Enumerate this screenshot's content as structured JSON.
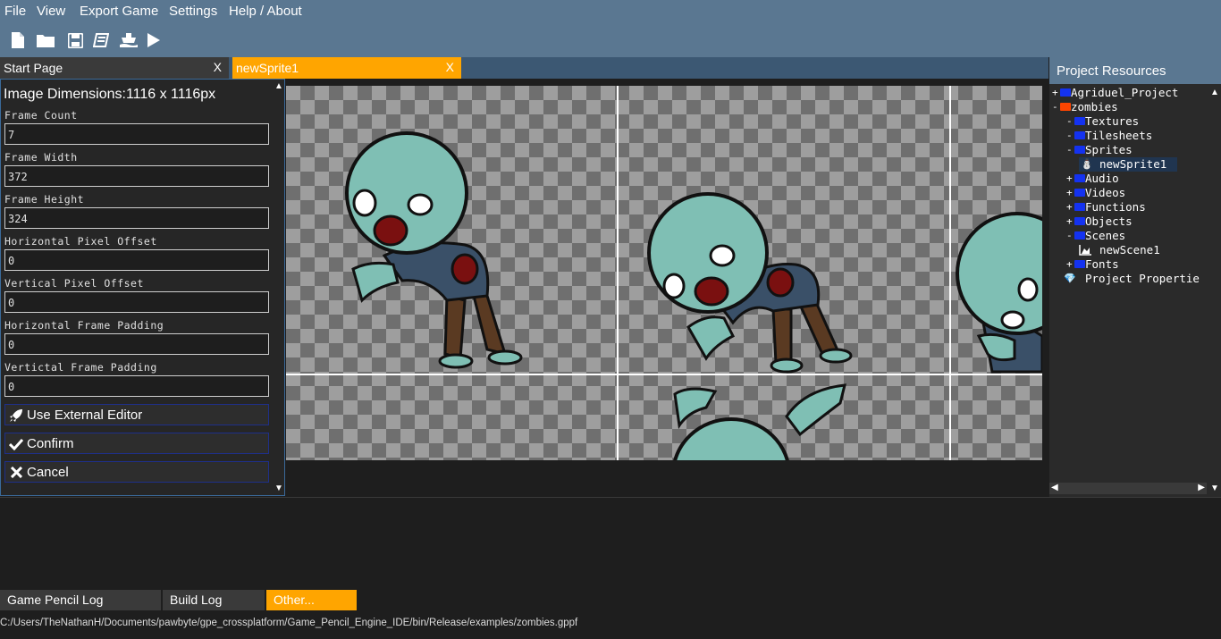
{
  "menu": {
    "file": "File",
    "view": "View",
    "export": "Export Game",
    "settings": "Settings",
    "help": "Help / About"
  },
  "toolbar": {
    "icons": [
      "new-file-icon",
      "open-folder-icon",
      "save-icon",
      "save-all-icon",
      "build-icon",
      "play-icon"
    ]
  },
  "tabs": [
    {
      "label": "Start Page",
      "close": "X"
    },
    {
      "label": "newSprite1",
      "close": "X"
    }
  ],
  "sprite_editor": {
    "dimensions": "Image Dimensions:1116 x 1116px",
    "fields": [
      {
        "label": "Frame Count",
        "value": "7"
      },
      {
        "label": "Frame Width",
        "value": "372"
      },
      {
        "label": "Frame Height",
        "value": "324"
      },
      {
        "label": "Horizontal Pixel  Offset",
        "value": "0"
      },
      {
        "label": "Vertical Pixel Offset",
        "value": "0"
      },
      {
        "label": "Horizontal Frame Padding",
        "value": "0"
      },
      {
        "label": "Vertictal Frame Padding",
        "value": "0"
      }
    ],
    "buttons": {
      "external": "Use External Editor",
      "confirm": "Confirm",
      "cancel": "Cancel"
    }
  },
  "resources": {
    "title": "Project Resources",
    "tree": [
      {
        "pm": "+",
        "label": "Agriduel_Project",
        "kind": "folder"
      },
      {
        "pm": "-",
        "label": "zombies",
        "kind": "project"
      },
      {
        "pm": "-",
        "label": "Textures",
        "kind": "folder"
      },
      {
        "pm": "-",
        "label": "Tilesheets",
        "kind": "folder"
      },
      {
        "pm": "-",
        "label": "Sprites",
        "kind": "folder"
      },
      {
        "pm": "",
        "label": "newSprite1",
        "kind": "sprite"
      },
      {
        "pm": "+",
        "label": "Audio",
        "kind": "folder"
      },
      {
        "pm": "+",
        "label": "Videos",
        "kind": "folder"
      },
      {
        "pm": "+",
        "label": "Functions",
        "kind": "folder"
      },
      {
        "pm": "+",
        "label": "Objects",
        "kind": "folder"
      },
      {
        "pm": "-",
        "label": "Scenes",
        "kind": "folder"
      },
      {
        "pm": "",
        "label": "newScene1",
        "kind": "scene"
      },
      {
        "pm": "+",
        "label": "Fonts",
        "kind": "folder"
      },
      {
        "pm": "",
        "label": "Project Propertie",
        "kind": "properties"
      }
    ]
  },
  "bottom_tabs": [
    "Game Pencil Log",
    "Build Log",
    "Other..."
  ],
  "status": {
    "path": "C:/Users/TheNathanH/Documents/pawbyte/gpe_crossplatform/Game_Pencil_Engine_IDE/bin/Release/examples/zombies.gppf"
  },
  "colors": {
    "header": "#5a7791",
    "tab_active": "#ffa500",
    "folder": "#1432f0",
    "project_folder": "#ff4500",
    "zombie_skin": "#7fbfb4",
    "zombie_shirt": "#3a5068",
    "zombie_pants": "#5a3a22"
  }
}
